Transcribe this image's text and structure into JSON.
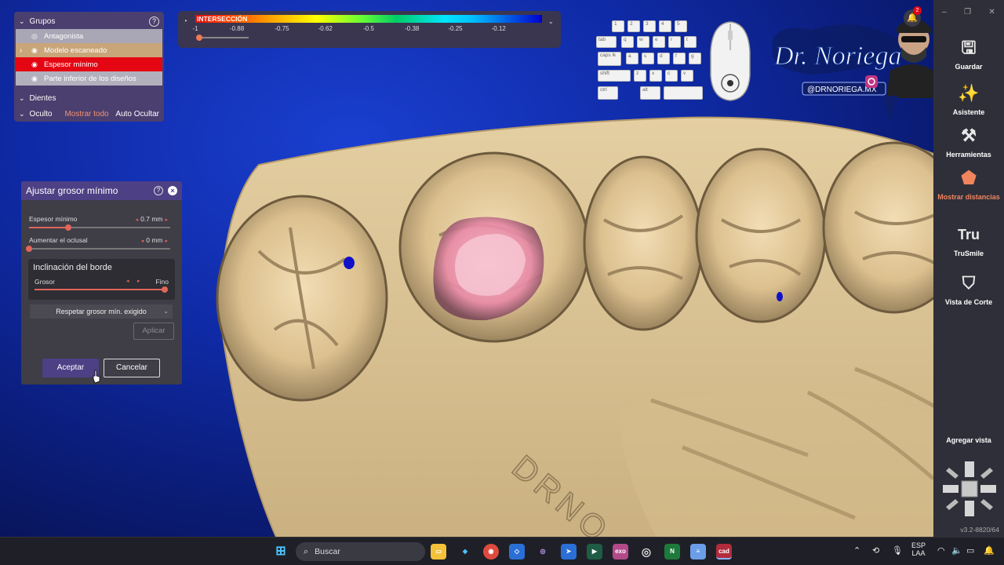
{
  "groups_panel": {
    "title": "Grupos",
    "items": [
      {
        "label": "Antagonista"
      },
      {
        "label": "Modelo escaneado"
      },
      {
        "label": "Espesor mínimo"
      },
      {
        "label": "Parte inferior de los diseños"
      }
    ],
    "teeth_label": "Dientes",
    "hidden_label": "Oculto",
    "show_all_label": "Mostrar todo",
    "auto_hide_label": "Auto Ocultar"
  },
  "color_scale": {
    "title": "INTERSECCIÓN",
    "ticks": [
      "-1",
      "-0.88",
      "-0.75",
      "-0.62",
      "-0.5",
      "-0.38",
      "-0.25",
      "-0.12"
    ]
  },
  "dialog": {
    "title": "Ajustar grosor mínimo",
    "min_thickness": {
      "label": "Espesor mínimo",
      "value": "0.7 mm",
      "fraction": 0.28
    },
    "occlusal_increase": {
      "label": "Aumentar el oclusal",
      "value": "0 mm",
      "fraction": 0.0
    },
    "edge_section": {
      "title": "Inclinación del borde",
      "left_label": "Grosor",
      "right_label": "Fino",
      "fraction": 1.0
    },
    "select_value": "Respetar grosor mín. exigido",
    "apply_label": "Aplicar",
    "accept_label": "Aceptar",
    "cancel_label": "Cancelar"
  },
  "keyboard": {
    "keys": [
      "1",
      "2",
      "3",
      "4",
      "5",
      "tab",
      "q",
      "w",
      "e",
      "r",
      "t",
      "caps lk",
      "a",
      "s",
      "d",
      "f",
      "g",
      "shift",
      "z",
      "x",
      "c",
      "v",
      "ctrl",
      "alt"
    ]
  },
  "logo": {
    "name": "Dr. Noriega",
    "handle": "@DRNORIEGA.MX"
  },
  "sidebar": {
    "items": [
      {
        "label": "Guardar",
        "icon": "save-icon"
      },
      {
        "label": "Asistente",
        "icon": "wizard-icon"
      },
      {
        "label": "Herramientas",
        "icon": "tools-icon"
      },
      {
        "label": "Mostrar distancias",
        "icon": "distance-icon"
      },
      {
        "label": "TruSmile",
        "icon": "trusmile-icon"
      },
      {
        "label": "Vista de Corte",
        "icon": "section-view-icon"
      }
    ],
    "add_view_label": "Agregar vista",
    "version": "v3.2-8820/64",
    "notification_count": "2"
  },
  "model_engraving": "DRNO",
  "taskbar": {
    "search_placeholder": "Buscar",
    "lang_top": "ESP",
    "lang_bottom": "LAA",
    "apps": [
      "exo",
      "cad"
    ]
  },
  "colors": {
    "accent": "#4d4085",
    "highlight": "#f0855d",
    "danger": "#e40613"
  }
}
